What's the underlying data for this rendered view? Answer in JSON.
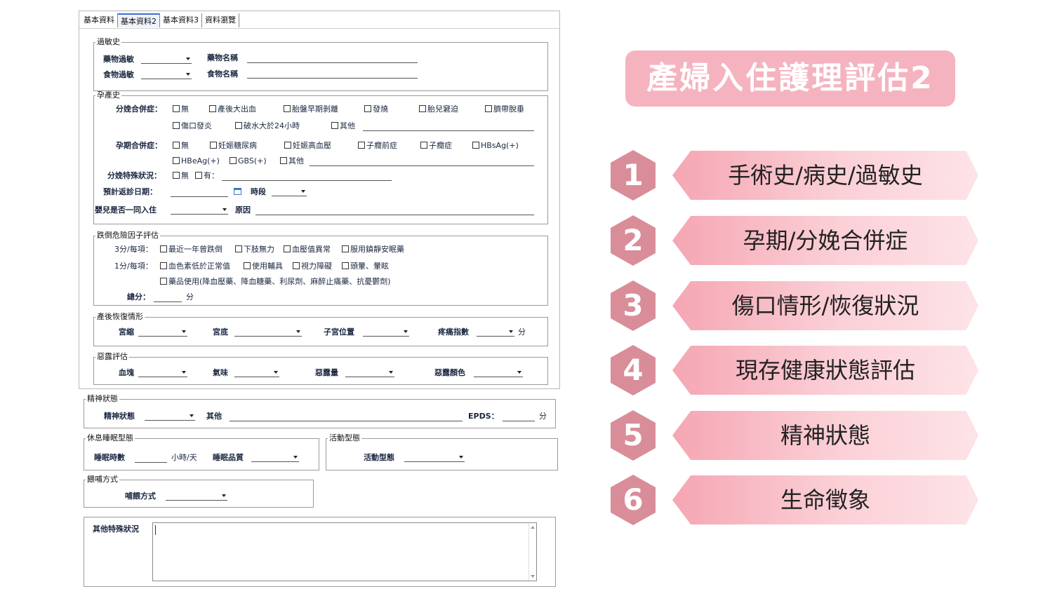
{
  "tabs": [
    "基本資料",
    "基本資料2",
    "基本資料3",
    "資料瀏覽"
  ],
  "allergy": {
    "legend": "過敏史",
    "drug_allergy": "藥物過敏",
    "drug_name": "藥物名稱",
    "food_allergy": "食物過敏",
    "food_name": "食物名稱"
  },
  "pregnancy": {
    "legend": "孕產史",
    "delivery_complication_label": "分娩合併症：",
    "delivery_options_row1": [
      "無",
      "產後大出血",
      "胎盤早期剝離",
      "發燒",
      "胎兒窘迫",
      "臍帶脫垂"
    ],
    "delivery_options_row2": [
      "傷口發炎",
      "破水大於24小時",
      "其他"
    ],
    "pregnancy_complication_label": "孕期合併症：",
    "pregnancy_options_row1": [
      "無",
      "妊娠糖尿病",
      "妊娠高血壓",
      "子癇前症",
      "子癇症",
      "HBsAg(+)"
    ],
    "pregnancy_options_row2": [
      "HBeAg(+)",
      "GBS(+)",
      "其他"
    ],
    "special_label": "分娩特殊狀況：",
    "special_options": [
      "無",
      "有："
    ],
    "return_date_label": "預計返診日期：",
    "period_label": "時段",
    "rooming_label": "嬰兒是否一同入住",
    "reason_label": "原因"
  },
  "fall": {
    "legend": "跌倒危險因子評估",
    "three_label": "3分/每項：",
    "three_items": [
      "最近一年曾跌倒",
      "下肢無力",
      "血壓值異常",
      "服用鎮靜安眠藥"
    ],
    "one_label": "1分/每項：",
    "one_items": [
      "血色素低於正常值",
      "使用輔具",
      "視力障礙",
      "頭暈、暈眩"
    ],
    "med_item": "藥品使用(降血壓藥、降血糖藥、利尿劑、麻醉止痛藥、抗憂鬱劑)",
    "total_label": "總分：",
    "unit": "分"
  },
  "postpartum": {
    "legend": "產後恢復情形",
    "fields": [
      "宮縮",
      "宮底",
      "子宮位置",
      "疼痛指數"
    ],
    "unit": "分"
  },
  "lochia": {
    "legend": "惡露評估",
    "fields": [
      "血塊",
      "氣味",
      "惡露量",
      "惡露顏色"
    ]
  },
  "mental": {
    "legend": "精神狀態",
    "state_label": "精神狀態",
    "other_label": "其他",
    "epds_label": "EPDS：",
    "unit": "分"
  },
  "sleep": {
    "legend": "休息睡眠型態",
    "hours_label": "睡眠時數",
    "hours_unit": "小時/天",
    "quality_label": "睡眠品質"
  },
  "activity": {
    "legend": "活動型態",
    "label": "活動型態"
  },
  "feeding": {
    "legend": "餵哺方式",
    "label": "哺餵方式"
  },
  "other_special": {
    "label": "其他特殊狀況"
  },
  "slide": {
    "title": "產婦入住護理評估2",
    "items": [
      {
        "num": "1",
        "label": "手術史/病史/過敏史"
      },
      {
        "num": "2",
        "label": "孕期/分娩合併症"
      },
      {
        "num": "3",
        "label": "傷口情形/恢復狀況"
      },
      {
        "num": "4",
        "label": "現存健康狀態評估"
      },
      {
        "num": "5",
        "label": "精神狀態"
      },
      {
        "num": "6",
        "label": "生命徵象"
      }
    ]
  },
  "colors": {
    "title_bg": "#f5b3bf",
    "hex": "#d98d99",
    "banner_start": "#f5a6b3",
    "banner_end": "#fde3e7"
  }
}
